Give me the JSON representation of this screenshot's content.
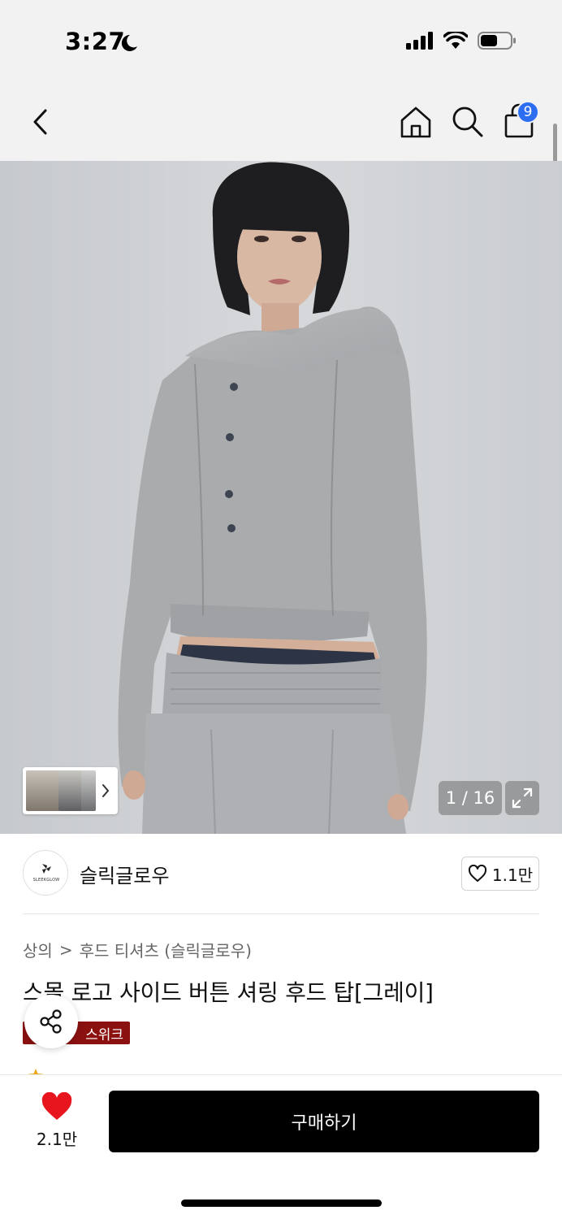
{
  "status_bar": {
    "time": "3:27"
  },
  "header": {
    "cart_badge": "9"
  },
  "gallery": {
    "counter": "1 / 16"
  },
  "brand": {
    "name": "슬릭글로우",
    "logo_text": "SLEEKGLOW",
    "likes": "1.1만"
  },
  "breadcrumb": {
    "level1": "상의",
    "separator": ">",
    "level2": "후드 티셔츠 (슬릭글로우)"
  },
  "product": {
    "title": "스몰 로고 사이드 버튼 셔링 후드 탑[그레이]",
    "tag": "스위크"
  },
  "bottom_bar": {
    "wish_count": "2.1만",
    "buy_label": "구매하기"
  },
  "colors": {
    "accent_blue": "#2c6df2",
    "heart_red": "#e8141e",
    "tag_red": "#8b1111"
  }
}
